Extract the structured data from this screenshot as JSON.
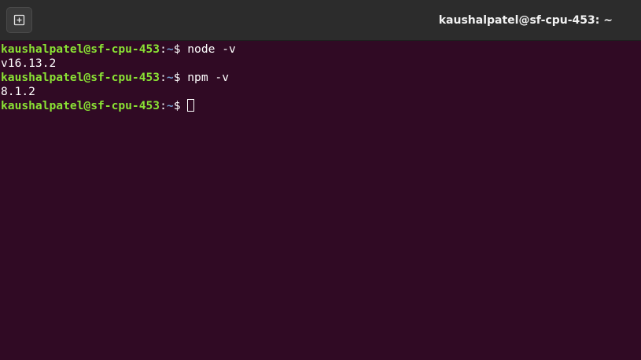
{
  "window": {
    "title": "kaushalpatel@sf-cpu-453: ~",
    "new_tab_icon": "new-tab-icon"
  },
  "colors": {
    "background": "#300a24",
    "user": "#8ae234",
    "path": "#729fcf",
    "text": "#ffffff"
  },
  "terminal": {
    "lines": [
      {
        "type": "prompt",
        "user_host": "kaushalpatel@sf-cpu-453",
        "sep": ":",
        "path": "~",
        "symbol": "$ ",
        "command": "node -v"
      },
      {
        "type": "output",
        "text": "v16.13.2"
      },
      {
        "type": "prompt",
        "user_host": "kaushalpatel@sf-cpu-453",
        "sep": ":",
        "path": "~",
        "symbol": "$ ",
        "command": "npm -v"
      },
      {
        "type": "output",
        "text": "8.1.2"
      },
      {
        "type": "prompt",
        "user_host": "kaushalpatel@sf-cpu-453",
        "sep": ":",
        "path": "~",
        "symbol": "$ ",
        "command": ""
      }
    ]
  }
}
